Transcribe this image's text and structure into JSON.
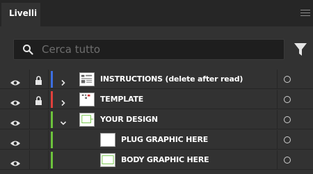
{
  "panel": {
    "tab_label": "Livelli",
    "menu_icon": "hamburger-menu-icon"
  },
  "search": {
    "placeholder": "Cerca tutto",
    "value": "",
    "icon": "search-icon",
    "filter_icon": "filter-icon"
  },
  "layers": [
    {
      "name": "INSTRUCTIONS (delete after read)",
      "visible": true,
      "locked": true,
      "color": "#3c6ee0",
      "expandable": true,
      "expanded": false,
      "indent": 0,
      "thumb": "instructions"
    },
    {
      "name": "TEMPLATE",
      "visible": true,
      "locked": true,
      "color": "#e0403c",
      "expandable": true,
      "expanded": false,
      "indent": 0,
      "thumb": "template"
    },
    {
      "name": "YOUR DESIGN",
      "visible": true,
      "locked": false,
      "color": "#6cc23c",
      "expandable": true,
      "expanded": true,
      "indent": 0,
      "thumb": "design"
    },
    {
      "name": "PLUG GRAPHIC HERE",
      "visible": true,
      "locked": false,
      "color": "#6cc23c",
      "expandable": false,
      "expanded": false,
      "indent": 1,
      "thumb": "plug"
    },
    {
      "name": "BODY GRAPHIC HERE",
      "visible": true,
      "locked": false,
      "color": "#6cc23c",
      "expandable": false,
      "expanded": false,
      "indent": 1,
      "thumb": "body"
    }
  ],
  "icons": {
    "visibility": "eye-icon",
    "lock": "lock-icon",
    "expand_collapsed": "chevron-right-icon",
    "expand_open": "chevron-down-icon",
    "target": "target-circle-icon"
  }
}
